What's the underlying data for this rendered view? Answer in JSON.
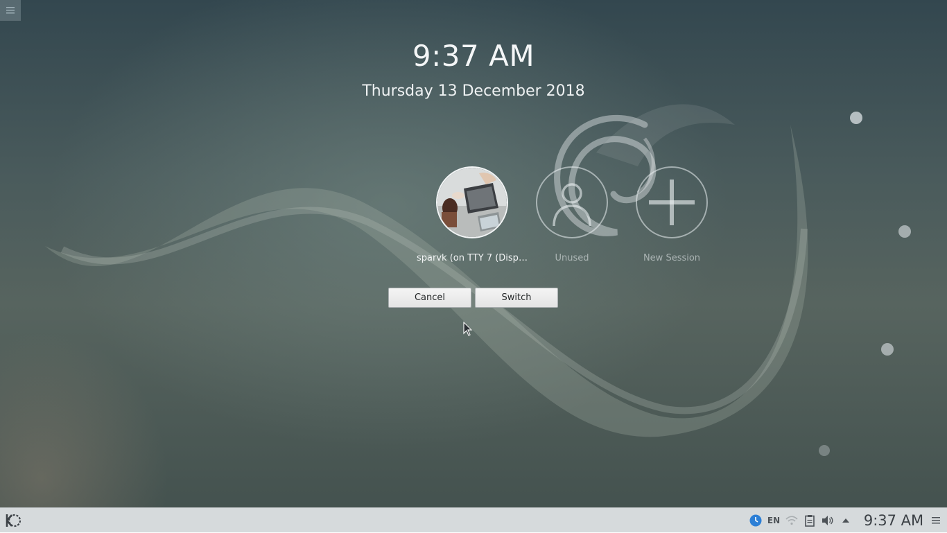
{
  "lockscreen": {
    "time": "9:37 AM",
    "date": "Thursday 13 December 2018"
  },
  "sessions": [
    {
      "label": "sparvk (on TTY 7 (Displ...",
      "icon": "user-photo",
      "state": "active"
    },
    {
      "label": "Unused",
      "icon": "user-placeholder-icon",
      "state": "inactive"
    },
    {
      "label": "New Session",
      "icon": "plus-icon",
      "state": "inactive"
    }
  ],
  "actions": {
    "cancel_label": "Cancel",
    "switch_label": "Switch"
  },
  "taskbar": {
    "launcher_icon": "kde-logo-icon",
    "keyboard_layout": "EN",
    "tray_icons": [
      "night-color-icon",
      "network-icon",
      "clipboard-icon",
      "volume-icon",
      "expand-tray-icon"
    ],
    "clock": "9:37 AM"
  },
  "colors": {
    "panel_bg": "#d6dadc",
    "button_bg": "#e9e9e9",
    "accent_blue": "#2c7fd6"
  }
}
